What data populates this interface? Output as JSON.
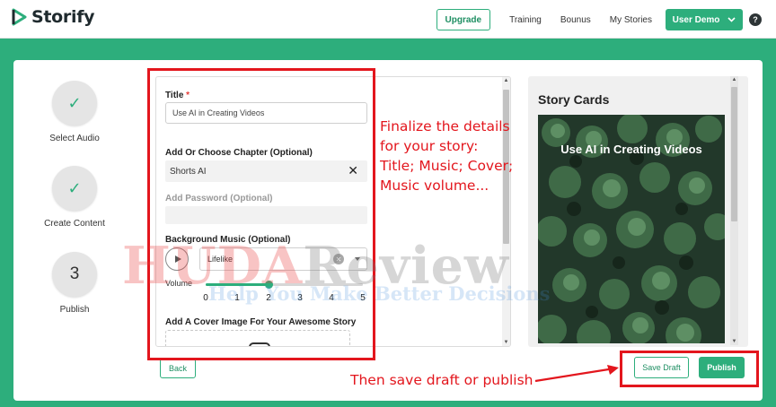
{
  "app": {
    "name": "Storify"
  },
  "header": {
    "nav": {
      "upgrade": "Upgrade",
      "training": "Training",
      "bonus": "Bounus",
      "my_stories": "My Stories"
    },
    "user_button": "User Demo",
    "help_icon": "?"
  },
  "steps": [
    {
      "label": "Select Audio",
      "state": "done"
    },
    {
      "label": "Create Content",
      "state": "done"
    },
    {
      "label": "Publish",
      "number": "3",
      "state": "current"
    }
  ],
  "form": {
    "title_label": "Title",
    "required_mark": "*",
    "title_value": "Use AI in Creating Videos",
    "chapter_label": "Add Or Choose Chapter (Optional)",
    "chapter_value": "Shorts AI",
    "password_label": "Add Password (Optional)",
    "music_label": "Background Music (Optional)",
    "music_value": "Lifelike",
    "volume_label": "Volume",
    "volume_ticks": [
      "0",
      "1",
      "2",
      "3",
      "4",
      "5"
    ],
    "volume_value": 2,
    "volume_max": 5,
    "cover_label": "Add A Cover Image For Your Awesome Story"
  },
  "buttons": {
    "back": "Back",
    "save_draft": "Save Draft",
    "publish": "Publish"
  },
  "story_cards": {
    "title": "Story Cards",
    "card_caption": "Use AI in Creating Videos"
  },
  "annotations": {
    "details_note": "Finalize the details\nfor your story:\nTitle; Music; Cover;\nMusic volume...",
    "save_note": "Then save draft or publish"
  },
  "watermark": {
    "brand_part1": "HUDA",
    "brand_part2": "Review",
    "tagline": "Help You Make Better Decisions"
  },
  "colors": {
    "accent": "#2dae7c",
    "annotation": "#e3161d"
  }
}
